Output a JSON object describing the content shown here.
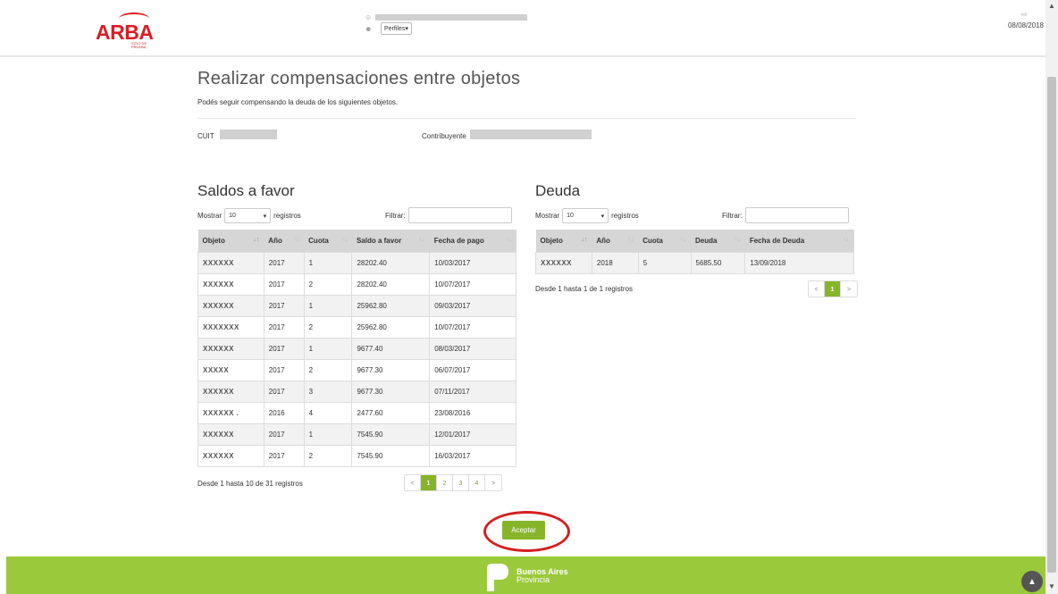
{
  "header": {
    "logo_text": "ARBA",
    "logo_sub": "SITIO DE PRUEBA",
    "perfiles_label": "Perfiles",
    "date": "08/08/2018"
  },
  "page": {
    "title": "Realizar compensaciones entre objetos",
    "subtitle": "Podés seguir compensando la deuda de los siguientes objetos.",
    "cuit_label": "CUIT",
    "contribuyente_label": "Contribuyente"
  },
  "saldos": {
    "title": "Saldos a favor",
    "mostrar": "Mostrar",
    "length_value": "10",
    "registros": "registros",
    "filtrar": "Filtrar:",
    "columns": [
      "Objeto",
      "Año",
      "Cuota",
      "Saldo a favor",
      "Fecha de pago"
    ],
    "rows": [
      [
        "XXXXXX",
        "2017",
        "1",
        "28202.40",
        "10/03/2017"
      ],
      [
        "XXXXXX",
        "2017",
        "2",
        "28202.40",
        "10/07/2017"
      ],
      [
        "XXXXXX",
        "2017",
        "1",
        "25962.80",
        "09/03/2017"
      ],
      [
        "XXXXXXX",
        "2017",
        "2",
        "25962.80",
        "10/07/2017"
      ],
      [
        "XXXXXX",
        "2017",
        "1",
        "9677.40",
        "08/03/2017"
      ],
      [
        "XXXXX",
        "2017",
        "2",
        "9677.30",
        "06/07/2017"
      ],
      [
        "XXXXXX",
        "2017",
        "3",
        "9677.30",
        "07/11/2017"
      ],
      [
        "XXXXXX .",
        "2016",
        "4",
        "2477.60",
        "23/08/2016"
      ],
      [
        "XXXXXX",
        "2017",
        "1",
        "7545.90",
        "12/01/2017"
      ],
      [
        "XXXXXX",
        "2017",
        "2",
        "7545.90",
        "16/03/2017"
      ]
    ],
    "info": "Desde 1 hasta 10 de 31 registros",
    "pages": [
      "<",
      "1",
      "2",
      "3",
      "4",
      ">"
    ]
  },
  "deuda": {
    "title": "Deuda",
    "mostrar": "Mostrar",
    "length_value": "10",
    "registros": "registros",
    "filtrar": "Filtrar:",
    "columns": [
      "Objeto",
      "Año",
      "Cuota",
      "Deuda",
      "Fecha de Deuda"
    ],
    "rows": [
      [
        "XXXXXX",
        "2018",
        "5",
        "5685.50",
        "13/09/2018"
      ]
    ],
    "info": "Desde 1 hasta 1 de 1 registros",
    "pages": [
      "<",
      "1",
      ">"
    ]
  },
  "actions": {
    "accept_label": "Aceptar"
  },
  "footer": {
    "brand_line1": "Buenos Aires",
    "brand_line2": "Provincia"
  }
}
